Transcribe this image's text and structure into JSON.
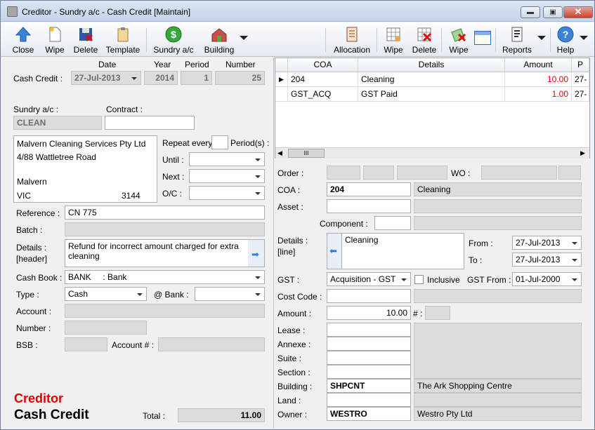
{
  "window": {
    "title": "Creditor - Sundry a/c - Cash Credit [Maintain]",
    "min_label": "▬",
    "max_label": "▣",
    "close_label": "✕"
  },
  "toolbar": {
    "close": "Close",
    "wipe": "Wipe",
    "delete": "Delete",
    "template": "Template",
    "sundry": "Sundry a/c",
    "building": "Building",
    "allocation": "Allocation",
    "wipe2": "Wipe",
    "delete2": "Delete",
    "wipe3": "Wipe",
    "reports": "Reports",
    "help": "Help"
  },
  "header": {
    "date_label": "Date",
    "year_label": "Year",
    "period_label": "Period",
    "number_label": "Number",
    "cash_credit_label": "Cash Credit :",
    "date": "27-Jul-2013",
    "year": "2014",
    "period": "1",
    "number": "25"
  },
  "sundry": {
    "label": "Sundry a/c :",
    "value": "CLEAN",
    "contract_label": "Contract :",
    "contract": ""
  },
  "address": {
    "line1": "Malvern Cleaning Services Pty Ltd",
    "line2": "4/88 Wattletree Road",
    "line3": "",
    "city": "Malvern",
    "state": "VIC",
    "postcode": "3144"
  },
  "repeat": {
    "label": "Repeat every",
    "periods_label": "Period(s) :",
    "value": "",
    "until_label": "Until :",
    "next_label": "Next :",
    "oc_label": "O/C :"
  },
  "fields": {
    "reference_label": "Reference :",
    "reference": "CN 775",
    "batch_label": "Batch :",
    "batch": "",
    "details_label": "Details :",
    "details_sub": "[header]",
    "details": "Refund for incorrect amount charged for extra cleaning",
    "cashbook_label": "Cash Book :",
    "cashbook": "BANK     : Bank",
    "type_label": "Type :",
    "type": "Cash",
    "atbank_label": "@ Bank :",
    "account_label": "Account :",
    "number_label": "Number :",
    "bsb_label": "BSB :",
    "accountno_label": "Account # :"
  },
  "footer": {
    "creditor": "Creditor",
    "cash_credit": "Cash Credit",
    "total_label": "Total :",
    "total": "11.00"
  },
  "grid": {
    "columns": [
      "COA",
      "Details",
      "Amount",
      "P"
    ],
    "rows": [
      {
        "coa": "204",
        "details": "Cleaning",
        "amount": "10.00",
        "p": "27-"
      },
      {
        "coa": "GST_ACQ",
        "details": "GST Paid",
        "amount": "1.00",
        "p": "27-"
      }
    ],
    "scroll_grip": "III"
  },
  "detail": {
    "order_label": "Order :",
    "wo_label": "WO :",
    "coa_label": "COA :",
    "coa": "204",
    "coa_name": "Cleaning",
    "asset_label": "Asset :",
    "component_label": "Component :",
    "details_label": "Details :",
    "details_sub": "[line]",
    "details": "Cleaning",
    "from_label": "From :",
    "from": "27-Jul-2013",
    "to_label": "To :",
    "to": "27-Jul-2013",
    "gst_label": "GST :",
    "gst": "Acquisition - GST",
    "inclusive_label": "Inclusive",
    "gstfrom_label": "GST From :",
    "gstfrom": "01-Jul-2000",
    "costcode_label": "Cost Code :",
    "amount_label": "Amount :",
    "amount": "10.00",
    "hash_label": "# :",
    "lease_label": "Lease :",
    "annexe_label": "Annexe :",
    "suite_label": "Suite :",
    "section_label": "Section :",
    "building_label": "Building :",
    "building": "SHPCNT",
    "building_name": "The Ark Shopping Centre",
    "land_label": "Land :",
    "owner_label": "Owner :",
    "owner": "WESTRO",
    "owner_name": "Westro Pty Ltd"
  },
  "colors": {
    "accent_red": "#e00000",
    "title_bg": "#dbe6f4"
  }
}
